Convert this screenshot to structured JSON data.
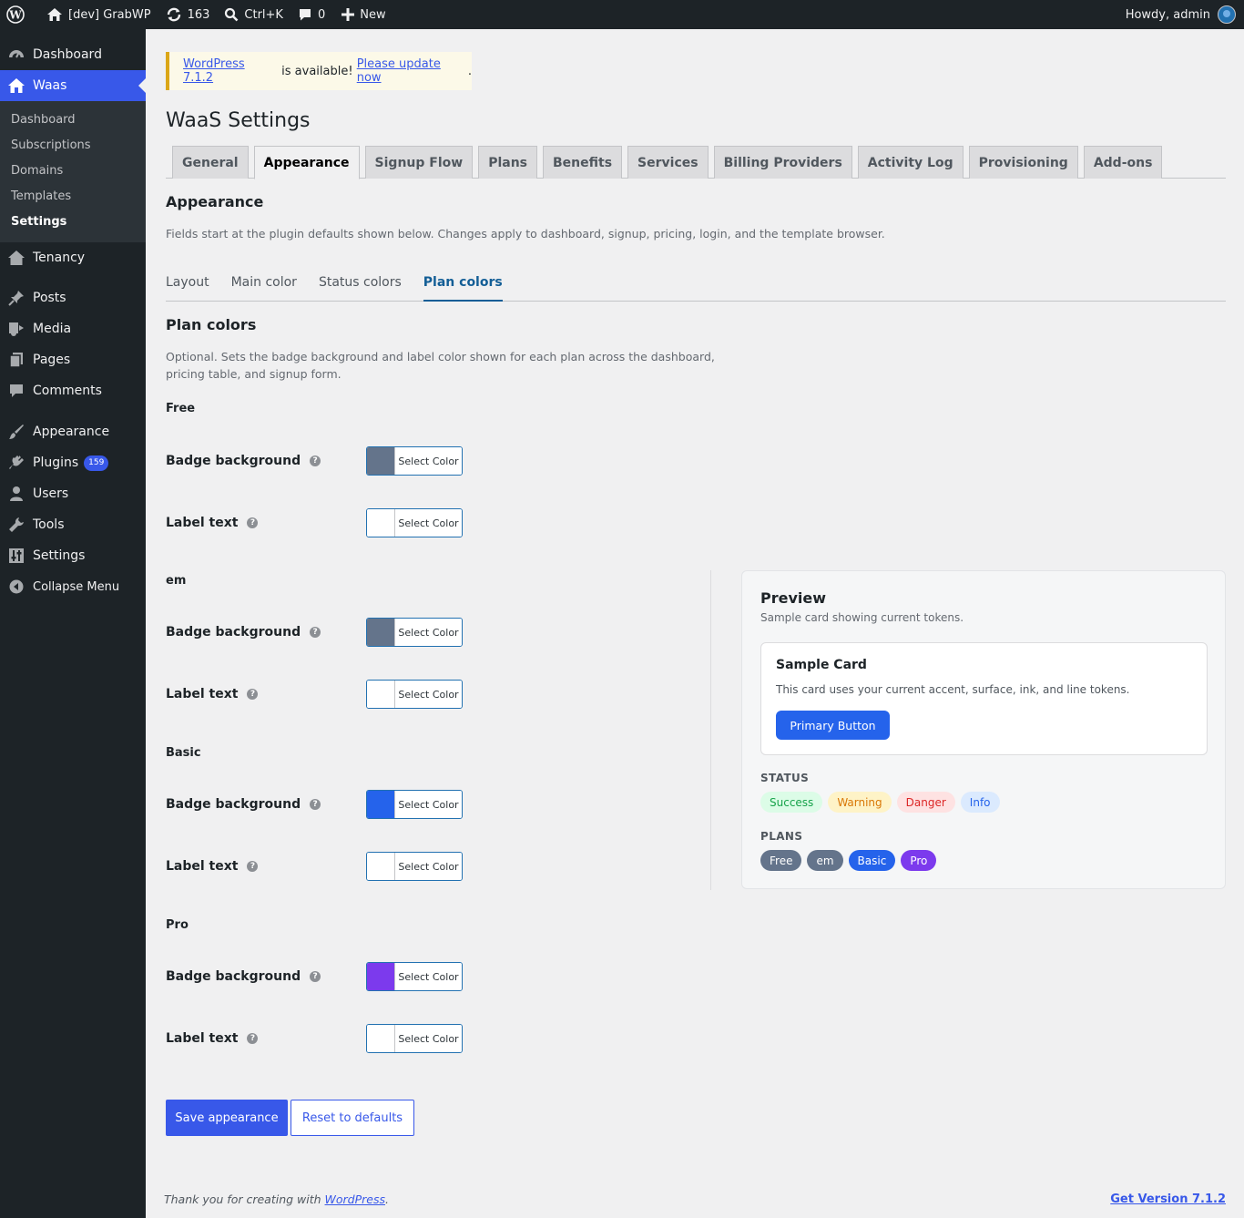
{
  "adminbar": {
    "site_name": "[dev] GrabWP",
    "updates_count": "163",
    "search_shortcut": "Ctrl+K",
    "comments_count": "0",
    "new_label": "New",
    "greeting": "Howdy, admin"
  },
  "sidebar": {
    "dashboard": "Dashboard",
    "waas": "Waas",
    "waas_sub": [
      "Dashboard",
      "Subscriptions",
      "Domains",
      "Templates",
      "Settings"
    ],
    "tenancy": "Tenancy",
    "posts": "Posts",
    "media": "Media",
    "pages": "Pages",
    "comments": "Comments",
    "appearance": "Appearance",
    "plugins": "Plugins",
    "plugins_count": "159",
    "users": "Users",
    "tools": "Tools",
    "settings": "Settings",
    "collapse": "Collapse Menu"
  },
  "notice": {
    "link1": "WordPress 7.1.2",
    "middle": " is available! ",
    "link2": "Please update now",
    "end": "."
  },
  "page_title": "WaaS Settings",
  "tabs": [
    "General",
    "Appearance",
    "Signup Flow",
    "Plans",
    "Benefits",
    "Services",
    "Billing Providers",
    "Activity Log",
    "Provisioning",
    "Add-ons"
  ],
  "active_tab": "Appearance",
  "appearance": {
    "heading": "Appearance",
    "description": "Fields start at the plugin defaults shown below. Changes apply to dashboard, signup, pricing, login, and the template browser."
  },
  "subtabs": [
    "Layout",
    "Main color",
    "Status colors",
    "Plan colors"
  ],
  "active_subtab": "Plan colors",
  "plan_colors": {
    "heading": "Plan colors",
    "description_line1": "Optional. Sets the badge background and label color shown for each plan across the dashboard,",
    "description_line2": "pricing table, and signup form.",
    "badge_label": "Badge background",
    "text_label": "Label text",
    "select_label": "Select Color",
    "plans": [
      {
        "name": "Free",
        "badge_color": "#64748b",
        "text_color": "#ffffff"
      },
      {
        "name": "em",
        "badge_color": "#64748b",
        "text_color": "#ffffff"
      },
      {
        "name": "Basic",
        "badge_color": "#2563eb",
        "text_color": "#ffffff"
      },
      {
        "name": "Pro",
        "badge_color": "#7c3aed",
        "text_color": "#ffffff"
      }
    ]
  },
  "preview": {
    "title": "Preview",
    "subtitle": "Sample card showing current tokens.",
    "card_title": "Sample Card",
    "card_text": "This card uses your current accent, surface, ink, and line tokens.",
    "button": "Primary Button",
    "status_label": "STATUS",
    "status": [
      {
        "label": "Success",
        "bg": "#dcfce7",
        "fg": "#16a34a"
      },
      {
        "label": "Warning",
        "bg": "#fef3c7",
        "fg": "#d97706"
      },
      {
        "label": "Danger",
        "bg": "#fee2e2",
        "fg": "#dc2626"
      },
      {
        "label": "Info",
        "bg": "#dbeafe",
        "fg": "#2563eb"
      }
    ],
    "plans_label": "PLANS",
    "plans": [
      "Free",
      "em",
      "Basic",
      "Pro"
    ]
  },
  "buttons": {
    "save": "Save appearance",
    "reset": "Reset to defaults"
  },
  "footer": {
    "thanks_prefix": "Thank you for creating with ",
    "thanks_link": "WordPress",
    "thanks_suffix": ".",
    "version": "Get Version 7.1.2"
  }
}
